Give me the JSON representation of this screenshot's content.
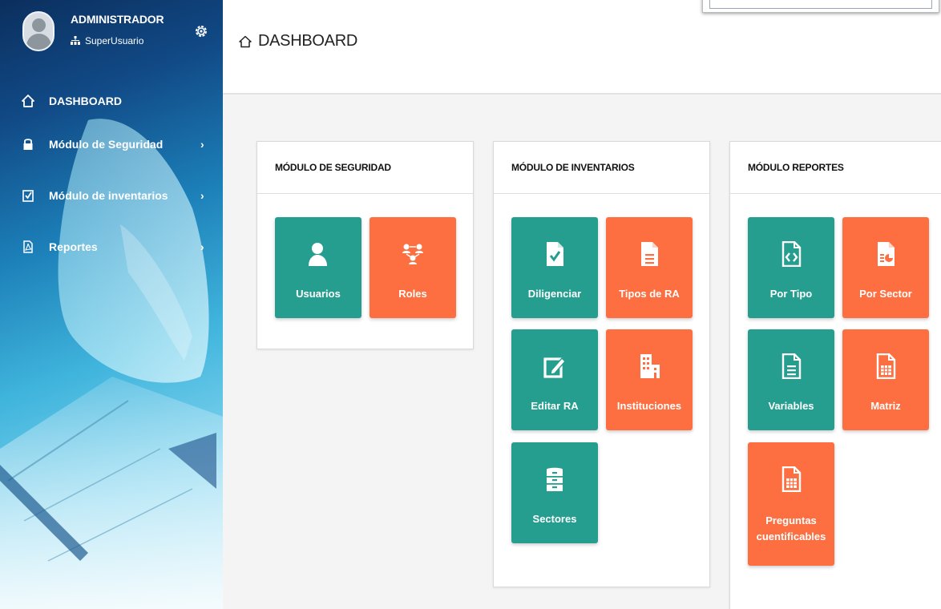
{
  "user": {
    "name": "ADMINISTRADOR",
    "role": "SuperUsuario"
  },
  "nav": {
    "dashboard": "DASHBOARD",
    "seguridad": "Módulo de Seguridad",
    "inventarios": "Módulo de inventarios",
    "reportes": "Reportes"
  },
  "page": {
    "title": "DASHBOARD"
  },
  "cards": {
    "seguridad": {
      "title": "MÓDULO DE SEGURIDAD",
      "tiles": [
        "Usuarios",
        "Roles"
      ]
    },
    "inventarios": {
      "title": "MÓDULO DE INVENTARIOS",
      "tiles": [
        "Diligenciar",
        "Tipos de RA",
        "Editar RA",
        "Instituciones",
        "Sectores"
      ]
    },
    "reportes": {
      "title": "MÓDULO REPORTES",
      "tiles": [
        "Por Tipo",
        "Por Sector",
        "Variables",
        "Matriz",
        "Preguntas",
        "cuentificables"
      ]
    }
  },
  "colors": {
    "teal": "#269e8f",
    "orange": "#fd6f41",
    "sidebar_dark": "#0b2f5e",
    "sidebar_light": "#7fd3ee"
  },
  "icons": {
    "user": "user-avatar-icon",
    "role": "sitemap-icon",
    "settings": "gear-icon",
    "dashboard": "home-icon",
    "seguridad": "lock-icon",
    "inventarios": "checklist-icon",
    "reportes": "pdf-icon",
    "chevron": "chevron-right-icon"
  }
}
